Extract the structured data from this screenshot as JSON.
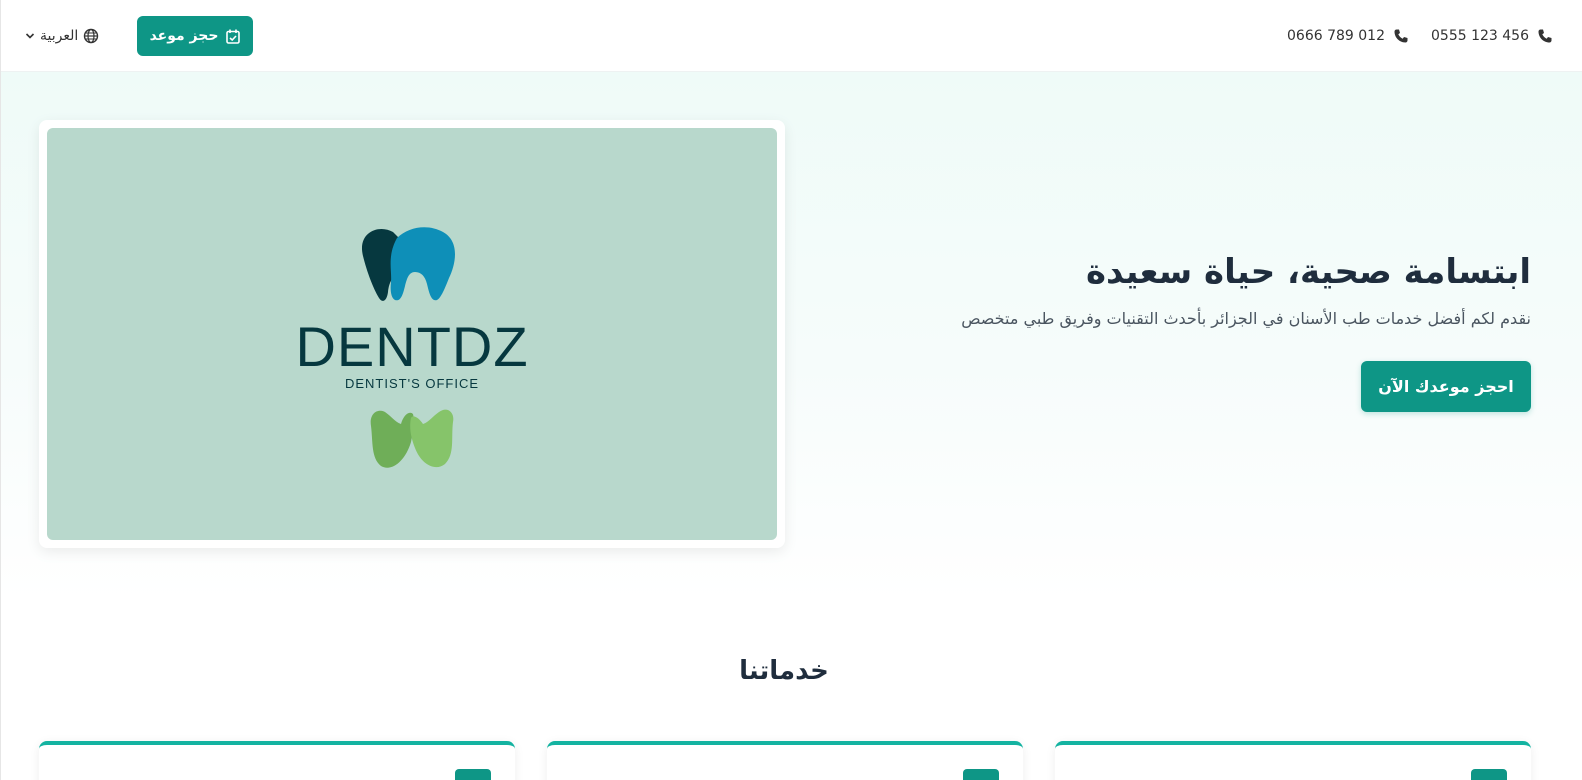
{
  "header": {
    "language_label": "العربية",
    "language_icon": "globe-icon",
    "book_button_label": "حجز موعد",
    "book_button_icon": "calendar-check-icon",
    "phones": [
      "0555 123 456",
      "0666 789 012"
    ],
    "phone_icon": "phone-icon"
  },
  "hero": {
    "title": "ابتسامة صحية، حياة سعيدة",
    "subtitle": "نقدم لكم أفضل خدمات طب الأسنان في الجزائر بأحدث التقنيات وفريق طبي متخصص",
    "cta_label": "احجز موعدك الآن",
    "image": {
      "brand_name": "DENTDZ",
      "brand_tagline": "DENTIST'S OFFICE"
    }
  },
  "services": {
    "title": "خدماتنا",
    "cards": [
      {},
      {},
      {}
    ]
  },
  "colors": {
    "primary": "#0e9686",
    "accent_border": "#14b3a1",
    "hero_bg": "#effbf8",
    "image_bg": "#b8d8cc",
    "tooth_dark": "#06383f",
    "tooth_blue": "#0e8fb8",
    "leaf_green": "#6fae58"
  }
}
